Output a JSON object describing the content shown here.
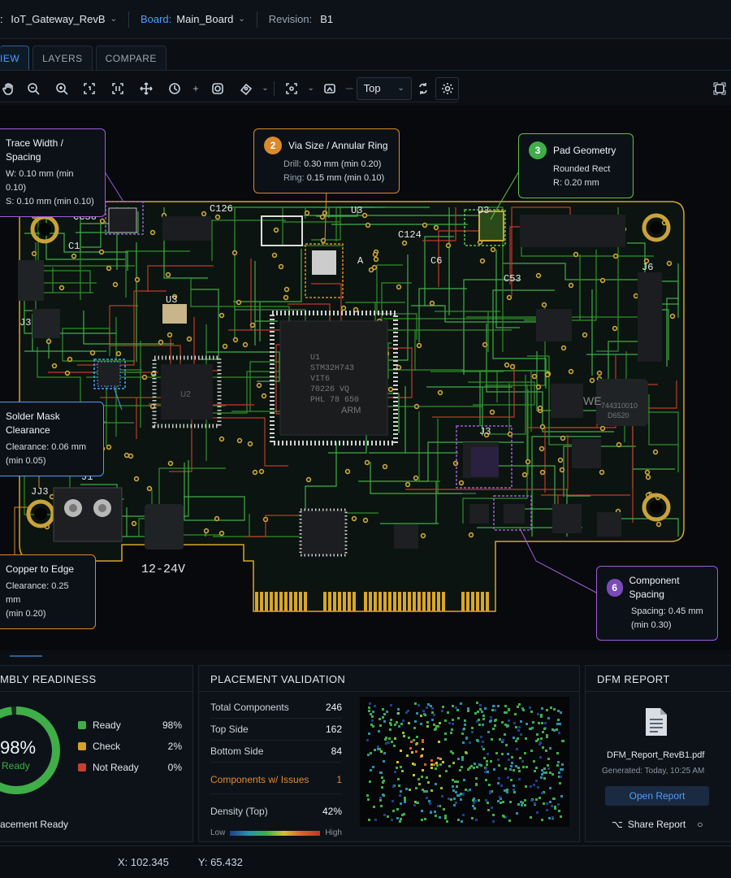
{
  "header": {
    "project": "IoT_Gateway_RevB",
    "board_label": "Board:",
    "board": "Main_Board",
    "revision_label": "Revision:",
    "revision": "B1"
  },
  "tabs": [
    "IEW",
    "LAYERS",
    "COMPARE"
  ],
  "toolbar": {
    "layer_select": "Top"
  },
  "callouts": {
    "trace": {
      "title": "Trace Width / Spacing",
      "l1": "W: 0.10 mm (min 0.10)",
      "l2": "S: 0.10 mm (min 0.10)"
    },
    "via": {
      "num": "2",
      "title": "Via Size / Annular Ring",
      "l1_label": "Drill:",
      "l1": "0.30 mm (min 0.20)",
      "l2_label": "Ring:",
      "l2": "0.15 mm (min 0.10)"
    },
    "pad": {
      "num": "3",
      "title": "Pad Geometry",
      "l1": "Rounded Rect",
      "l2": "R: 0.20 mm"
    },
    "mask": {
      "title": "Solder Mask Clearance",
      "l1": "Clearance: 0.06 mm",
      "l2": "(min 0.05)"
    },
    "edge": {
      "title": "Copper to Edge",
      "l1": "Clearance: 0.25 mm",
      "l2": "(min 0.20)"
    },
    "spacing": {
      "num": "6",
      "title": "Component Spacing",
      "l1": "Spacing: 0.45 mm",
      "l2": "(min 0.30)"
    }
  },
  "board_labels": {
    "c126": "C126",
    "c124": "C124",
    "c36": "CC36",
    "c53": "C53",
    "c1": "C1",
    "c6": "C6",
    "j1": "J1",
    "j3": "J3",
    "j3b": "J3",
    "jj3": "JJ3",
    "u3": "U3",
    "u3b": "U3",
    "u2": "U2",
    "j6": "J6",
    "voltage": "12-24V",
    "d3": "D3",
    "a": "A"
  },
  "mcu": {
    "l1": "U1",
    "l2": "STM32H743",
    "l3": "VIT6",
    "l4": "70226 VQ",
    "l5": "PHL 78 650",
    "l6": "ARM"
  },
  "inductor": {
    "brand": "WE",
    "l1": "744310010",
    "l2": "D6520"
  },
  "readiness": {
    "title": "MBLY READINESS",
    "percent": "98%",
    "label": "Ready",
    "progress": 0.98,
    "items": [
      {
        "name": "Ready",
        "value": "98%",
        "color": "#3fae48"
      },
      {
        "name": "Check",
        "value": "2%",
        "color": "#d4a12b"
      },
      {
        "name": "Not Ready",
        "value": "0%",
        "color": "#c8402f"
      }
    ],
    "footer": "acement Ready"
  },
  "placement": {
    "title": "PLACEMENT VALIDATION",
    "rows": [
      {
        "label": "Total Components",
        "value": "246"
      },
      {
        "label": "Top Side",
        "value": "162"
      },
      {
        "label": "Bottom Side",
        "value": "84"
      }
    ],
    "issues_label": "Components w/ Issues",
    "issues_value": "1",
    "density_label": "Density (Top)",
    "density_value": "42%",
    "low": "Low",
    "high": "High"
  },
  "dfm": {
    "title": "DFM REPORT",
    "filename": "DFM_Report_RevB1.pdf",
    "generated": "Generated:  Today, 10:25 AM",
    "open": "Open Report",
    "share": "Share Report"
  },
  "status": {
    "x": "X:  102.345",
    "y": "Y:  65.432"
  }
}
